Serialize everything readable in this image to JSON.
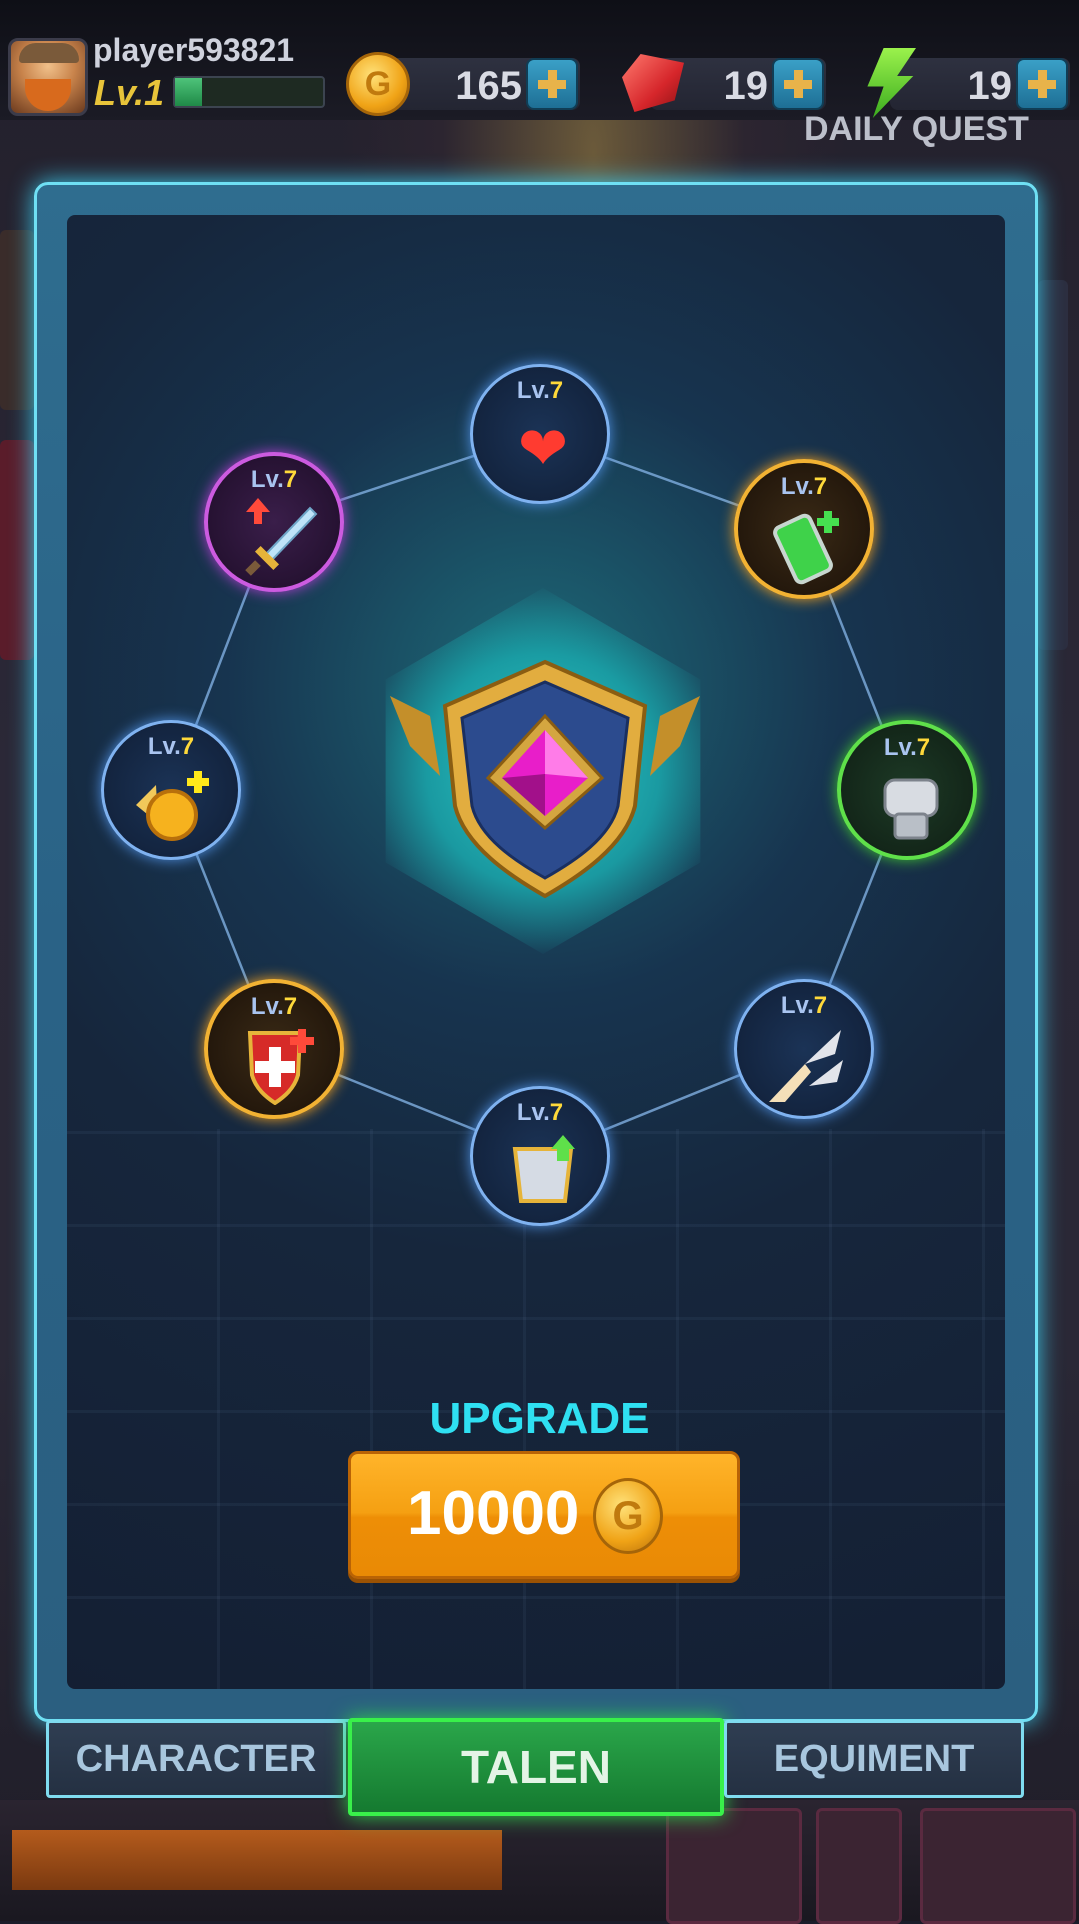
{
  "hud": {
    "player_name": "player593821",
    "level": "Lv.1",
    "xp_fraction": 0.18,
    "coins": "165",
    "coin_symbol": "G",
    "gems": "19",
    "energy": "19",
    "daily_quest": "DAILY QUEST"
  },
  "talents": [
    {
      "id": "health",
      "level_prefix": "Lv.",
      "level": "7",
      "icon": "heart-icon"
    },
    {
      "id": "battery",
      "level_prefix": "Lv.",
      "level": "7",
      "icon": "battery-icon"
    },
    {
      "id": "fist",
      "level_prefix": "Lv.",
      "level": "7",
      "icon": "fist-icon"
    },
    {
      "id": "missile",
      "level_prefix": "Lv.",
      "level": "7",
      "icon": "missile-icon"
    },
    {
      "id": "armor",
      "level_prefix": "Lv.",
      "level": "7",
      "icon": "armor-icon"
    },
    {
      "id": "shield",
      "level_prefix": "Lv.",
      "level": "7",
      "icon": "shield-cross-icon"
    },
    {
      "id": "coin",
      "level_prefix": "Lv.",
      "level": "7",
      "icon": "winged-coin-icon"
    },
    {
      "id": "sword",
      "level_prefix": "Lv.",
      "level": "7",
      "icon": "sword-icon"
    }
  ],
  "upgrade": {
    "label": "UPGRADE",
    "cost": "10000",
    "coin_symbol": "G"
  },
  "tabs": [
    {
      "label": "CHARACTER",
      "active": false
    },
    {
      "label": "TALEN",
      "active": true
    },
    {
      "label": "EQUIMENT",
      "active": false
    }
  ],
  "colors": {
    "accent_cyan": "#2fe0f2",
    "gold": "#ffd93a",
    "upgrade_orange": "#f5a012",
    "active_tab_green": "#39f04a"
  }
}
